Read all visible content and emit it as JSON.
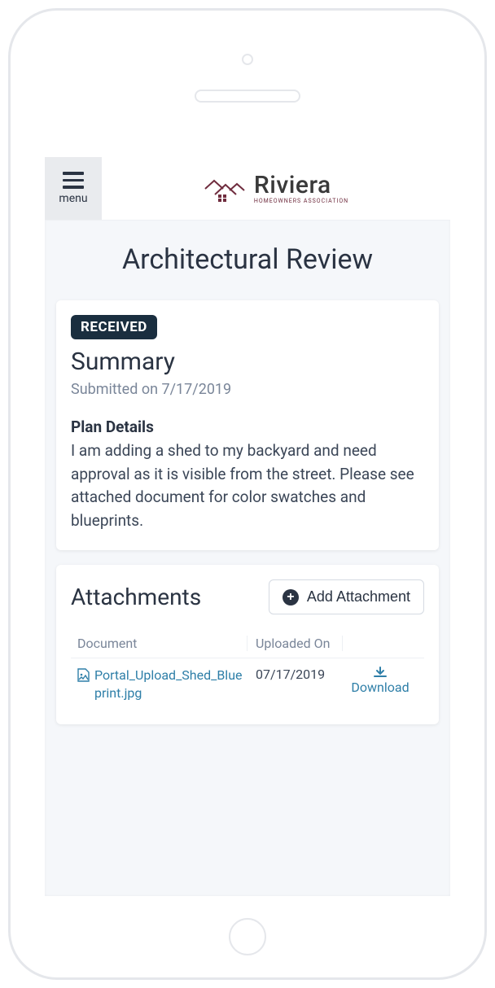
{
  "header": {
    "menu_label": "menu",
    "brand_name": "Riviera",
    "brand_sub": "Homeowners Association"
  },
  "page": {
    "title": "Architectural Review"
  },
  "summary": {
    "badge": "RECEIVED",
    "heading": "Summary",
    "submitted_prefix": "Submitted on ",
    "submitted_date": "7/17/2019",
    "plan_label": "Plan Details",
    "plan_text": "I am adding a shed to my backyard and need approval as it is visible from the street. Please see attached document for color swatches and blueprints."
  },
  "attachments": {
    "heading": "Attachments",
    "add_label": "Add Attachment",
    "columns": {
      "doc": "Document",
      "uploaded": "Uploaded On"
    },
    "rows": [
      {
        "name": "Portal_Upload_Shed_Blueprint.jpg",
        "uploaded": "07/17/2019",
        "action": "Download"
      }
    ]
  }
}
